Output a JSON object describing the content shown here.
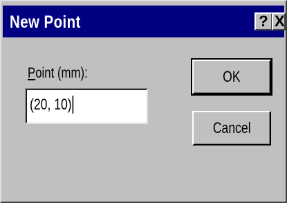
{
  "window": {
    "title": "New Point",
    "help_label": "?",
    "close_label": "X"
  },
  "form": {
    "label_accel": "P",
    "label_rest": "oint (mm):",
    "value": "(20, 10)"
  },
  "buttons": {
    "ok_label": "OK",
    "cancel_label": "Cancel"
  },
  "colors": {
    "titlebar": "#000080",
    "face": "#c0c0c0"
  }
}
